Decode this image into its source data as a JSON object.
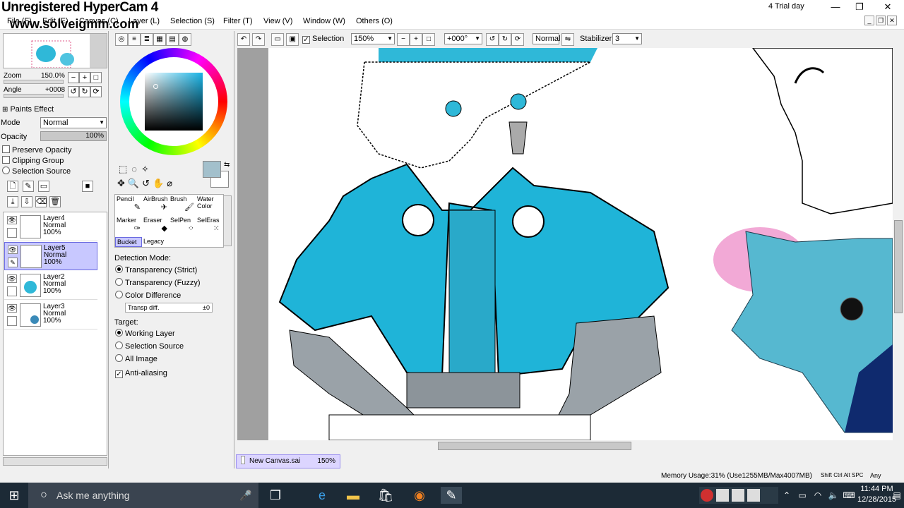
{
  "watermark": {
    "line1": "Unregistered HyperCam 4",
    "line2": "www.solveigmm.com"
  },
  "titlebar": {
    "trial": "4 Trial day",
    "minimize": "—",
    "restore": "❐",
    "close": "✕"
  },
  "menu": [
    "File (F)",
    "Edit (E)",
    "Canvas (C)",
    "Layer (L)",
    "Selection (S)",
    "Filter (T)",
    "View (V)",
    "Window (W)",
    "Others (O)"
  ],
  "toolbar": {
    "selection_label": "Selection",
    "zoom": "150%",
    "angle": "+000°",
    "mode": "Normal",
    "stabilizer_label": "Stabilizer",
    "stabilizer_value": "3"
  },
  "navigator": {
    "zoom_label": "Zoom",
    "zoom_value": "150.0%",
    "angle_label": "Angle",
    "angle_value": "+0008"
  },
  "layer_props": {
    "paints_effect": "Paints Effect",
    "mode_label": "Mode",
    "mode_value": "Normal",
    "opacity_label": "Opacity",
    "opacity_value": "100%",
    "preserve_opacity": "Preserve Opacity",
    "clipping_group": "Clipping Group",
    "selection_source": "Selection Source"
  },
  "layers": [
    {
      "name": "Layer4",
      "mode": "Normal",
      "opacity": "100%"
    },
    {
      "name": "Layer5",
      "mode": "Normal",
      "opacity": "100%"
    },
    {
      "name": "Layer2",
      "mode": "Normal",
      "opacity": "100%"
    },
    {
      "name": "Layer3",
      "mode": "Normal",
      "opacity": "100%"
    }
  ],
  "tools": [
    {
      "label": "Pencil"
    },
    {
      "label": "AirBrush"
    },
    {
      "label": "Brush"
    },
    {
      "label": "Water Color"
    },
    {
      "label": "Marker"
    },
    {
      "label": "Eraser"
    },
    {
      "label": "SelPen"
    },
    {
      "label": "SelEras"
    },
    {
      "label": "Bucket"
    },
    {
      "label": "Legacy"
    }
  ],
  "bucket": {
    "detection_label": "Detection Mode:",
    "opt_strict": "Transparency (Strict)",
    "opt_fuzzy": "Transparency (Fuzzy)",
    "opt_color": "Color Difference",
    "transp_label": "Transp diff.",
    "transp_value": "±0",
    "target_label": "Target:",
    "t_working": "Working Layer",
    "t_selection": "Selection Source",
    "t_all": "All Image",
    "antialias": "Anti-aliasing"
  },
  "colors": {
    "current": "#a3c0cc",
    "accent": "#19b4e6"
  },
  "tab": {
    "name": "New Canvas.sai",
    "zoom": "150%"
  },
  "status": {
    "memory": "Memory Usage:31% (Use1255MB/Max4007MB)",
    "keys": "Shift Ctrl Alt SPC",
    "any": "Any"
  },
  "taskbar": {
    "search": "Ask me anything",
    "time": "11:44 PM",
    "date": "12/28/2015"
  }
}
